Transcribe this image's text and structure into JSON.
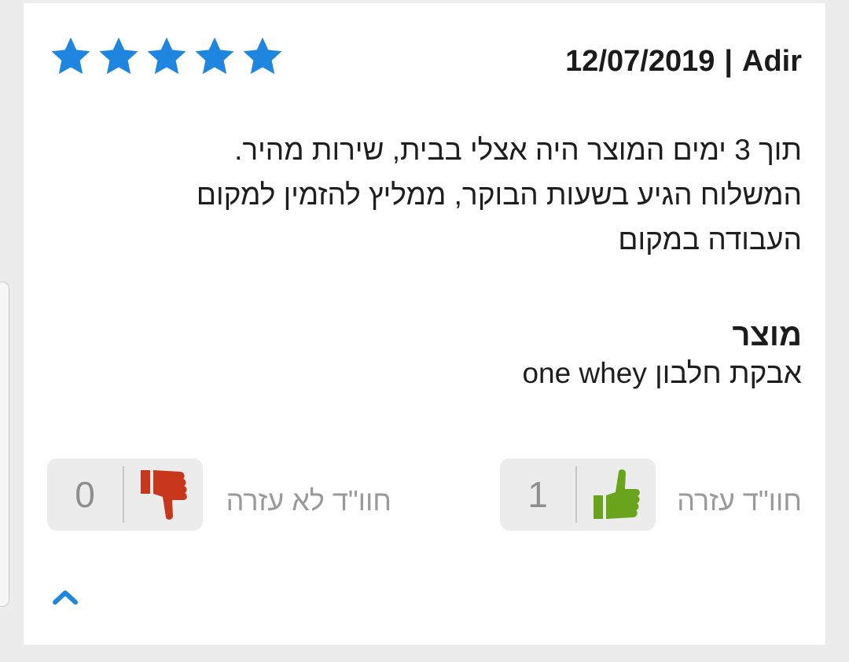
{
  "review": {
    "rating": 5,
    "rating_max": 5,
    "star_color": "#1f86e0",
    "date": "12/07/2019",
    "separator": "|",
    "author": "Adir",
    "text_lines": [
      "תוך 3 ימים המוצר היה אצלי בבית, שירות מהיר.",
      "המשלוח הגיע בשעות הבוקר, ממליץ להזמין למקום",
      "העבודה במקום"
    ],
    "product_heading": "מוצר",
    "product_name": "אבקת חלבון one whey"
  },
  "votes": {
    "helpful": {
      "label": "חוו\"ד עזרה",
      "count": "1",
      "icon": "thumbs-up-icon",
      "color": "#6aa31c"
    },
    "not_helpful": {
      "label": "חוו\"ד לא עזרה",
      "count": "0",
      "icon": "thumbs-down-icon",
      "color": "#c8371c"
    }
  },
  "collapse": {
    "icon": "chevron-up-icon",
    "color": "#1f86e0"
  }
}
